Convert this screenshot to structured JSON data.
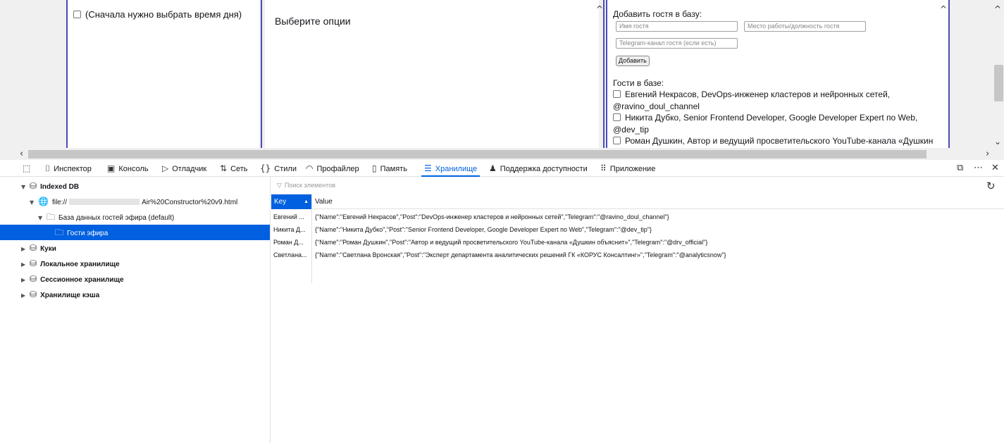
{
  "page": {
    "col1": {
      "checkbox_label": "(Сначала нужно выбрать время дня)"
    },
    "col2": {
      "title": "Выберите опции"
    },
    "col3": {
      "add_title": "Добавить гостя в базу:",
      "name_placeholder": "Имя гостя",
      "post_placeholder": "Место работы/должность гостя",
      "telegram_placeholder": "Telegram-канал гостя (если есть)",
      "add_button": "Добавить",
      "guests_title": "Гости в базе:",
      "guests": [
        {
          "line1": "Евгений Некрасов, DevOps-инженер кластеров и нейронных сетей,",
          "line2": "@ravino_doul_channel"
        },
        {
          "line1": "Никита Дубко, Senior Frontend Developer, Google Developer Expert по Web,",
          "line2": "@dev_tip"
        },
        {
          "line1": "Роман Душкин, Автор и ведущий просветительского YouTube-канала «Душкин",
          "line2": ""
        }
      ]
    }
  },
  "devtools": {
    "tabs": [
      {
        "icon": "⌷",
        "label": "Инспектор"
      },
      {
        "icon": "▣",
        "label": "Консоль"
      },
      {
        "icon": "▷",
        "label": "Отладчик"
      },
      {
        "icon": "⇅",
        "label": "Сеть"
      },
      {
        "icon": "{}",
        "label": "Стили"
      },
      {
        "icon": "◠",
        "label": "Профайлер"
      },
      {
        "icon": "▯",
        "label": "Память"
      },
      {
        "icon": "☰",
        "label": "Хранилище"
      },
      {
        "icon": "♟",
        "label": "Поддержка доступности"
      },
      {
        "icon": "⠿",
        "label": "Приложение"
      }
    ],
    "active_tab": "Хранилище",
    "sidebar": {
      "indexed_db": "Indexed DB",
      "file": "file://",
      "file_tail": "Air%20Constructor%20v9.html",
      "database": "База данных гостей эфира (default)",
      "store": "Гости эфира",
      "cookies": "Куки",
      "local": "Локальное хранилище",
      "session": "Сессионное хранилище",
      "cache": "Хранилище кэша"
    },
    "table": {
      "filter_placeholder": "Поиск элементов",
      "col_key": "Key",
      "col_value": "Value",
      "rows": [
        {
          "key": "Евгений ...",
          "value": "{\"Name\":\"Евгений Некрасов\",\"Post\":\"DevOps-инженер кластеров и нейронных сетей\",\"Telegram\":\"@ravino_doul_channel\"}"
        },
        {
          "key": "Никита Д...",
          "value": "{\"Name\":\"Никита Дубко\",\"Post\":\"Senior Frontend Developer, Google Developer Expert по Web\",\"Telegram\":\"@dev_tip\"}"
        },
        {
          "key": "Роман Д...",
          "value": "{\"Name\":\"Роман Душкин\",\"Post\":\"Автор и ведущий просветительского YouTube-канала «Душкин объяснит»\",\"Telegram\":\"@drv_official\"}"
        },
        {
          "key": "Светлана...",
          "value": "{\"Name\":\"Светлана Вронская\",\"Post\":\"Эксперт департамента аналитических решений ГК «КОРУС Консалтинг»\",\"Telegram\":\"@analyticsnow\"}"
        }
      ]
    },
    "accent_color": "#0060df"
  }
}
